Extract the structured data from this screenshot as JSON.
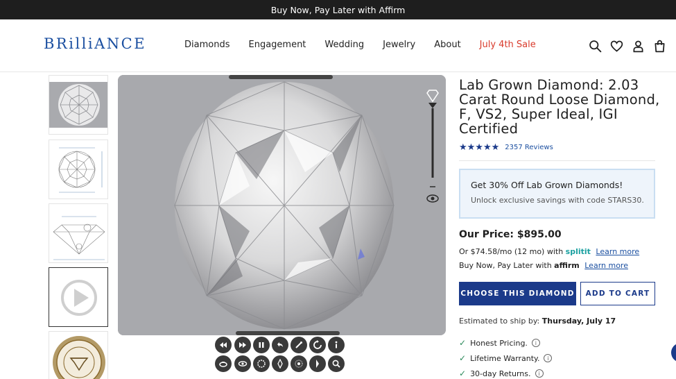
{
  "topbar": {
    "promo": "Buy Now, Pay Later with Affirm"
  },
  "header": {
    "logo": "BRilliANCE",
    "nav": [
      "Diamonds",
      "Engagement",
      "Wedding",
      "Jewelry",
      "About"
    ],
    "sale": "July 4th Sale",
    "icons": [
      "search-icon",
      "heart-icon",
      "user-icon",
      "cart-icon"
    ]
  },
  "gallery": {
    "thumbnails": [
      "diamond-photo",
      "top-view-diagram",
      "side-profile-diagram",
      "video-play",
      "igi-certificate-seal"
    ],
    "selected": 3
  },
  "product": {
    "title": "Lab Grown Diamond: 2.03 Carat Round Loose Diamond, F, VS2, Super Ideal, IGI Certified",
    "stars": "★★★★★",
    "reviews": "2357 Reviews",
    "promo_heading": "Get 30% Off Lab Grown Diamonds!",
    "promo_sub": "Unlock exclusive savings with code STARS30.",
    "price": "Our Price: $895.00",
    "split_text": "Or $74.58/mo (12 mo) with",
    "split_brand": "splitit",
    "split_link": "Learn more",
    "affirm_text": "Buy Now, Pay Later with",
    "affirm_brand": "affirm",
    "affirm_link": "Learn more",
    "choose_button": "CHOOSE THIS DIAMOND",
    "cart_button": "ADD TO CART",
    "ship_label": "Estimated to ship by:",
    "ship_date": "Thursday, July 17",
    "features": [
      "Honest Pricing.",
      "Lifetime Warranty.",
      "30-day Returns."
    ]
  },
  "colors": {
    "brand": "#1b3a8a",
    "sale": "#d93a2b",
    "topbar": "#1e1e1e",
    "promo_bg": "#eef4fb"
  }
}
